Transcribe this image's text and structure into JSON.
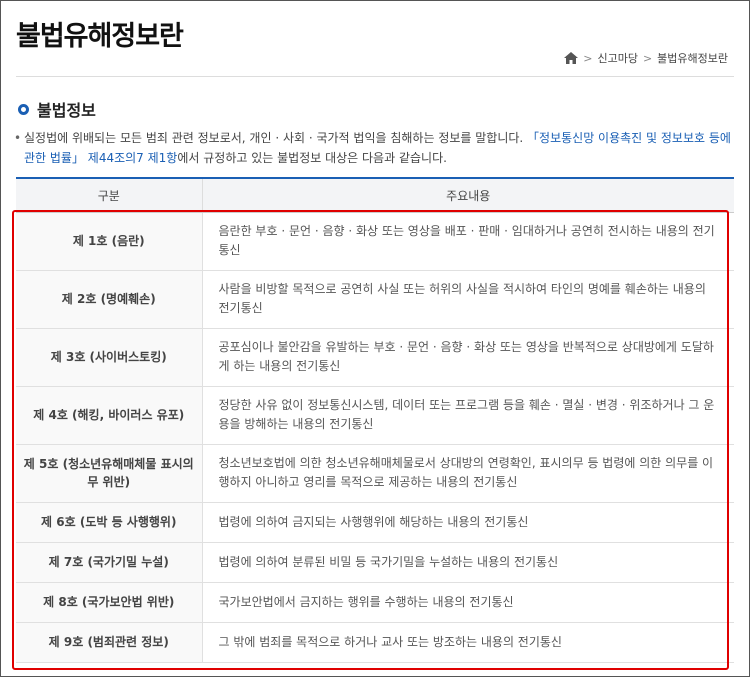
{
  "header": {
    "title": "불법유해정보란",
    "breadcrumb": [
      "신고마당",
      "불법유해정보란"
    ]
  },
  "section": {
    "title": "불법정보",
    "intro_before": "실정법에 위배되는 모든 범죄 관련 정보로서, 개인 · 사회 · 국가적 법익을 침해하는 정보를 말합니다. ",
    "intro_link": "「정보통신망 이용촉진 및 정보보호 등에 관한 법률」 제44조의7 제1항",
    "intro_after": "에서 규정하고 있는 불법정보 대상은 다음과 같습니다."
  },
  "table": {
    "headers": [
      "구분",
      "주요내용"
    ],
    "rows": [
      {
        "category": "제 1호 (음란)",
        "content": "음란한 부호 · 문언 · 음향 · 화상 또는 영상을 배포 · 판매 · 임대하거나 공연히 전시하는 내용의 전기통신"
      },
      {
        "category": "제 2호 (명예훼손)",
        "content": "사람을 비방할 목적으로 공연히 사실 또는 허위의 사실을 적시하여 타인의 명예를 훼손하는 내용의 전기통신"
      },
      {
        "category": "제 3호 (사이버스토킹)",
        "content": "공포심이나 불안감을 유발하는 부호 · 문언 · 음향 · 화상 또는 영상을 반복적으로 상대방에게 도달하게 하는 내용의 전기통신"
      },
      {
        "category": "제 4호 (해킹, 바이러스 유포)",
        "content": "정당한 사유 없이 정보통신시스템, 데이터 또는 프로그램 등을 훼손 · 멸실 · 변경 · 위조하거나 그 운용을 방해하는 내용의 전기통신"
      },
      {
        "category": "제 5호 (청소년유해매체물 표시의무 위반)",
        "content": "청소년보호법에 의한 청소년유해매체물로서 상대방의 연령확인, 표시의무 등 법령에 의한 의무를 이행하지 아니하고 영리를 목적으로 제공하는 내용의 전기통신"
      },
      {
        "category": "제 6호 (도박 등 사행행위)",
        "content": "법령에 의하여 금지되는 사행행위에 해당하는 내용의 전기통신"
      },
      {
        "category": "제 7호 (국가기밀 누설)",
        "content": "법령에 의하여 분류된 비밀 등 국가기밀을 누설하는 내용의 전기통신"
      },
      {
        "category": "제 8호 (국가보안법 위반)",
        "content": "국가보안법에서 금지하는 행위를 수행하는 내용의 전기통신"
      },
      {
        "category": "제 9호 (범죄관련 정보)",
        "content": "그 밖에 범죄를 목적으로 하거나 교사 또는 방조하는 내용의 전기통신"
      }
    ]
  },
  "colors": {
    "accent": "#1a5fb4",
    "highlight": "#e00000"
  }
}
